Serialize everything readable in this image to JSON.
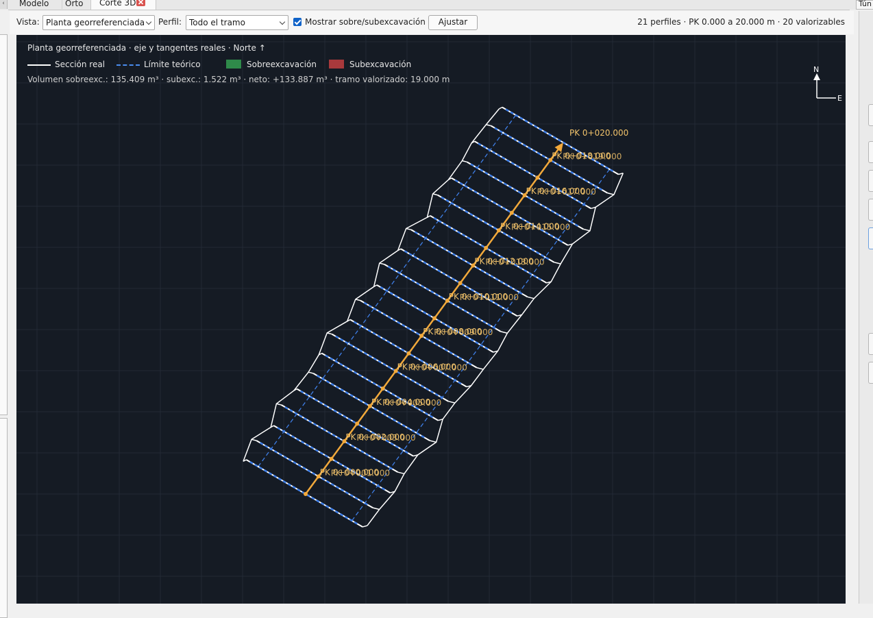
{
  "tabs": [
    {
      "label": "Modelo",
      "active": false
    },
    {
      "label": "Orto",
      "active": false
    },
    {
      "label": "Corte 3D",
      "active": true,
      "closable": true
    }
  ],
  "right_tab_label": "Tún",
  "toolbar": {
    "vista_label": "Vista:",
    "vista_value": "Planta georreferenciada",
    "perfil_label": "Perfil:",
    "perfil_value": "Todo el tramo",
    "checkbox_label": "Mostrar sobre/subexcavación",
    "checkbox_checked": true,
    "ajustar_label": "Ajustar",
    "summary": "21 perfiles · PK 0.000 a 20.000 m · 20 valorizables"
  },
  "canvas": {
    "title": "Planta georreferenciada · eje y tangentes reales · Norte ↑",
    "volumes": "Volumen sobreexc.: 135.409 m³ · subexc.: 1.522 m³ · neto: +133.887 m³ · tramo valorizado: 19.000 m",
    "end_label": "PK 0+020.000",
    "compass": {
      "north": "N",
      "east": "E"
    },
    "legend": [
      {
        "label": "Sección real",
        "kind": "line",
        "color": "#ffffff"
      },
      {
        "label": "Límite teórico",
        "kind": "dash",
        "color": "#4a8df0"
      },
      {
        "label": "Sobreexcavación",
        "kind": "box",
        "color": "#2f8a4a"
      },
      {
        "label": "Subexcavación",
        "kind": "box",
        "color": "#a8393c"
      }
    ],
    "pk_labels": [
      "PK 0+000.000",
      "PK 0+001.000",
      "PK 0+002.000",
      "PK 0+003.000",
      "PK 0+004.000",
      "PK 0+005.000",
      "PK 0+006.000",
      "PK 0+007.000",
      "PK 0+008.000",
      "PK 0+009.000",
      "PK 0+010.000",
      "PK 0+011.000",
      "PK 0+012.000",
      "PK 0+013.000",
      "PK 0+014.000",
      "PK 0+015.000",
      "PK 0+016.000",
      "PK 0+017.000",
      "PK 0+018.000",
      "PK 0+019.000"
    ],
    "colors": {
      "background": "#151b24",
      "grid": "#222a35",
      "axis": "#f2a93b",
      "section": "#ffffff",
      "theoretical": "#3f7fe8",
      "pk_text": "#f2c36b"
    }
  }
}
